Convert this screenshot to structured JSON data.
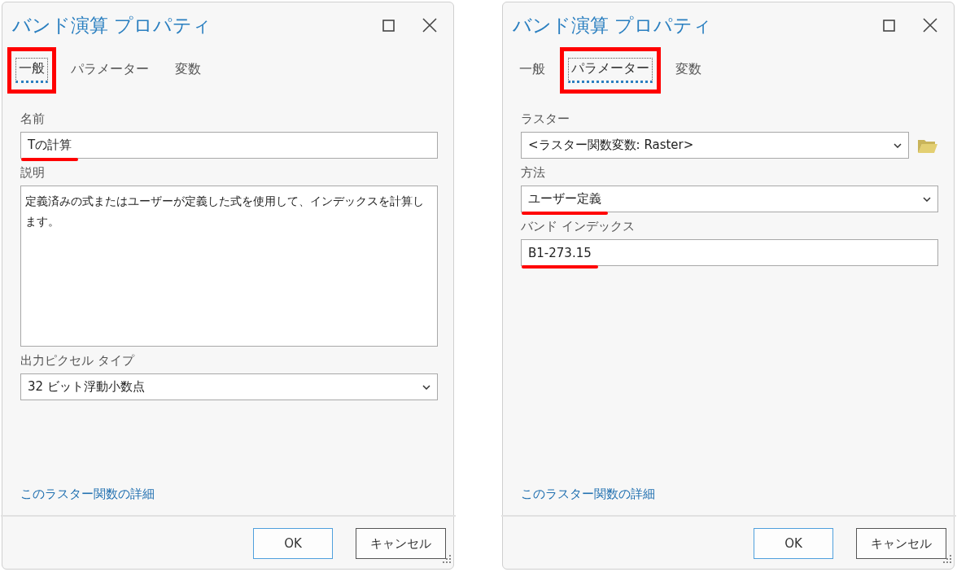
{
  "dialogs": [
    {
      "title": "バンド演算 プロパティ",
      "tabs": [
        {
          "label": "一般",
          "selected": true,
          "highlighted": true
        },
        {
          "label": "パラメーター",
          "selected": false,
          "highlighted": false
        },
        {
          "label": "変数",
          "selected": false,
          "highlighted": false
        }
      ],
      "fields": [
        {
          "kind": "text",
          "label": "名前",
          "value": "Tの計算",
          "underlined": true
        },
        {
          "kind": "textarea",
          "label": "説明",
          "value": "定義済みの式またはユーザーが定義した式を使用して、インデックスを計算します。",
          "underlined": false
        },
        {
          "kind": "select",
          "label": "出力ピクセル タイプ",
          "value": "32 ビット浮動小数点",
          "underlined": false
        }
      ],
      "link": "このラスター関数の詳細",
      "buttons": [
        {
          "label": "OK",
          "kind": "primary"
        },
        {
          "label": "キャンセル",
          "kind": "secondary"
        }
      ]
    },
    {
      "title": "バンド演算 プロパティ",
      "tabs": [
        {
          "label": "一般",
          "selected": false,
          "highlighted": false
        },
        {
          "label": "パラメーター",
          "selected": true,
          "highlighted": true
        },
        {
          "label": "変数",
          "selected": false,
          "highlighted": false
        }
      ],
      "fields": [
        {
          "kind": "select-browse",
          "label": "ラスター",
          "value": "<ラスター関数変数: Raster>",
          "underlined": false
        },
        {
          "kind": "select",
          "label": "方法",
          "value": "ユーザー定義",
          "underlined": true
        },
        {
          "kind": "text",
          "label": "バンド インデックス",
          "value": "B1-273.15",
          "underlined": true
        }
      ],
      "link": "このラスター関数の詳細",
      "buttons": [
        {
          "label": "OK",
          "kind": "primary"
        },
        {
          "label": "キャンセル",
          "kind": "secondary"
        }
      ]
    }
  ]
}
